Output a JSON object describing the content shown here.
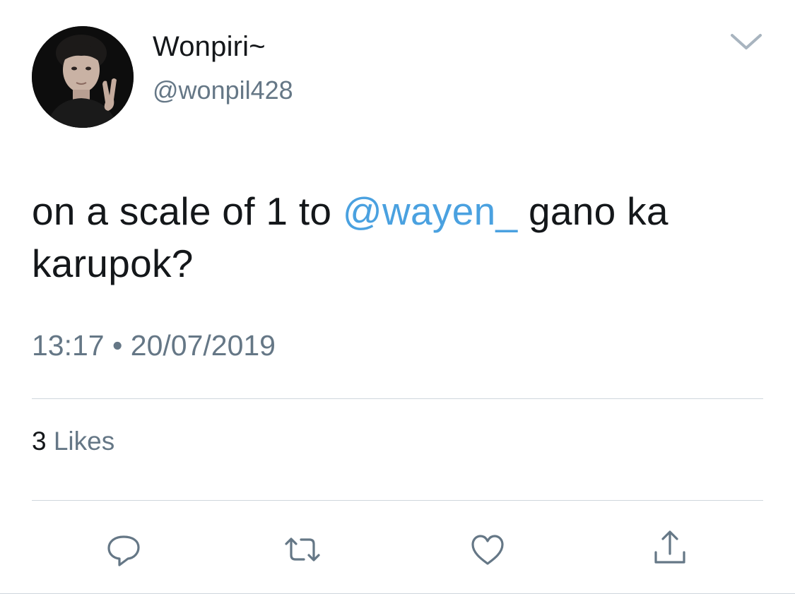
{
  "author": {
    "display_name": "Wonpiri~",
    "handle": "@wonpil428",
    "avatar_icon": "profile-photo"
  },
  "header": {
    "menu_icon": "chevron-down-icon"
  },
  "tweet": {
    "text_before": "on a scale of 1 to ",
    "mention": "@wayen_",
    "text_after": " gano ka karupok?",
    "time": "13:17",
    "separator": "•",
    "date": "20/07/2019"
  },
  "stats": {
    "likes_count": "3",
    "likes_label": "Likes"
  },
  "actions": [
    {
      "name": "reply",
      "icon": "reply-icon"
    },
    {
      "name": "retweet",
      "icon": "retweet-icon"
    },
    {
      "name": "like",
      "icon": "heart-icon"
    },
    {
      "name": "share",
      "icon": "share-icon"
    }
  ],
  "colors": {
    "mention": "#4aa1e0",
    "secondary_text": "#657786",
    "primary_text": "#14171a",
    "icon": "#657786",
    "divider": "#cfd6dc"
  }
}
